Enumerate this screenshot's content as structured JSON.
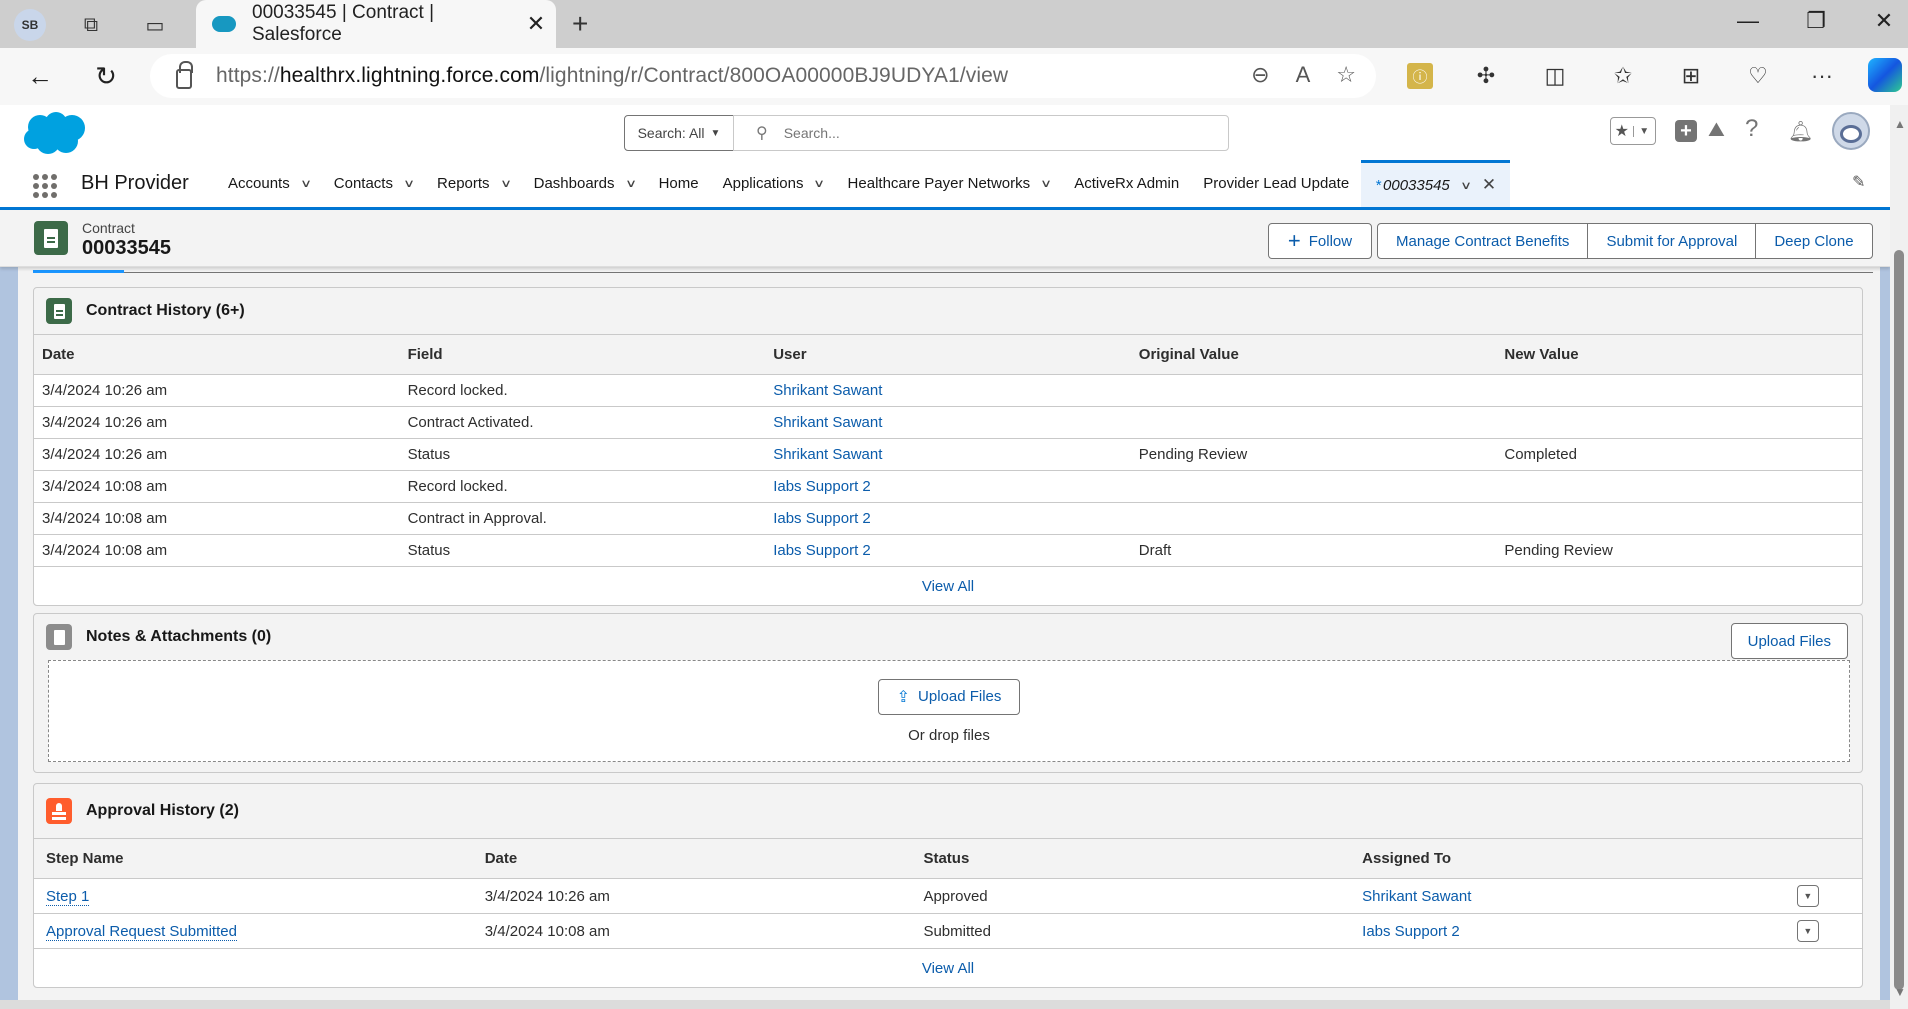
{
  "browser": {
    "profile_initials": "SB",
    "tab_title": "00033545 | Contract | Salesforce",
    "url_prefix": "https://",
    "url_host": "healthrx.lightning.force.com",
    "url_path": "/lightning/r/Contract/800OA00000BJ9UDYA1/view"
  },
  "header": {
    "search_scope": "Search: All",
    "search_placeholder": "Search..."
  },
  "nav": {
    "app_name": "BH Provider",
    "items": [
      {
        "label": "Accounts",
        "dropdown": true
      },
      {
        "label": "Contacts",
        "dropdown": true
      },
      {
        "label": "Reports",
        "dropdown": true
      },
      {
        "label": "Dashboards",
        "dropdown": true
      },
      {
        "label": "Home",
        "dropdown": false
      },
      {
        "label": "Applications",
        "dropdown": true
      },
      {
        "label": "Healthcare Payer Networks",
        "dropdown": true
      },
      {
        "label": "ActiveRx Admin",
        "dropdown": false
      },
      {
        "label": "Provider Lead Update",
        "dropdown": false
      }
    ],
    "active_tab": {
      "marker": "*",
      "label": "00033545"
    }
  },
  "record": {
    "object_type": "Contract",
    "name": "00033545",
    "actions": {
      "follow": "Follow",
      "manage_benefits": "Manage Contract Benefits",
      "submit_approval": "Submit for Approval",
      "deep_clone": "Deep Clone"
    }
  },
  "contract_history": {
    "title": "Contract History (6+)",
    "columns": [
      "Date",
      "Field",
      "User",
      "Original Value",
      "New Value"
    ],
    "rows": [
      {
        "date": "3/4/2024 10:26 am",
        "field": "Record locked.",
        "user": "Shrikant Sawant",
        "original": "",
        "new": ""
      },
      {
        "date": "3/4/2024 10:26 am",
        "field": "Contract Activated.",
        "user": "Shrikant Sawant",
        "original": "",
        "new": ""
      },
      {
        "date": "3/4/2024 10:26 am",
        "field": "Status",
        "user": "Shrikant Sawant",
        "original": "Pending Review",
        "new": "Completed"
      },
      {
        "date": "3/4/2024 10:08 am",
        "field": "Record locked.",
        "user": "Iabs Support 2",
        "original": "",
        "new": ""
      },
      {
        "date": "3/4/2024 10:08 am",
        "field": "Contract in Approval.",
        "user": "Iabs Support 2",
        "original": "",
        "new": ""
      },
      {
        "date": "3/4/2024 10:08 am",
        "field": "Status",
        "user": "Iabs Support 2",
        "original": "Draft",
        "new": "Pending Review"
      }
    ],
    "view_all": "View All"
  },
  "notes": {
    "title": "Notes & Attachments (0)",
    "upload_button": "Upload Files",
    "drop_upload_button": "Upload Files",
    "drop_text": "Or drop files"
  },
  "approval_history": {
    "title": "Approval History (2)",
    "columns": [
      "Step Name",
      "Date",
      "Status",
      "Assigned To"
    ],
    "rows": [
      {
        "step": "Step 1",
        "date": "3/4/2024 10:26 am",
        "status": "Approved",
        "assigned": "Shrikant Sawant"
      },
      {
        "step": "Approval Request Submitted",
        "date": "3/4/2024 10:08 am",
        "status": "Submitted",
        "assigned": "Iabs Support 2"
      }
    ],
    "view_all": "View All"
  },
  "colors": {
    "brand_blue": "#0176d3",
    "link": "#0b5cab",
    "contract_icon": "#3c6a48",
    "approval_icon": "#ff5d2d",
    "notes_icon": "#8c8c8c"
  }
}
